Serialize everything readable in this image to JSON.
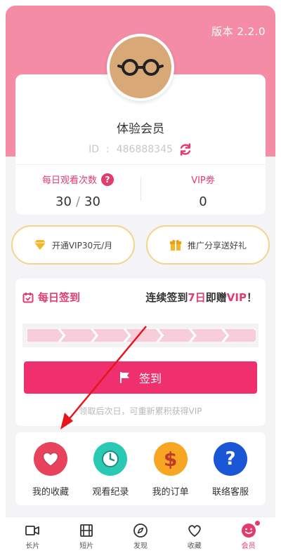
{
  "header": {
    "version": "版本 2.2.0",
    "accent": "#f58ca5"
  },
  "profile": {
    "nickname": "体验会员",
    "id_label": "ID",
    "id_value": "486888345",
    "avatar_icon": "glasses-avatar-icon",
    "refresh_icon": "refresh-icon"
  },
  "stats": {
    "daily_label": "每日观看次数",
    "help_icon_text": "?",
    "daily_used": "30",
    "daily_total": "30",
    "daily_sep": "/",
    "vip_label": "VIP劵",
    "vip_value": "0"
  },
  "promo": {
    "open_vip": "开通VIP30元/月",
    "share": "推广分享送好礼",
    "open_vip_icon": "diamond-icon",
    "share_icon": "gift-icon",
    "border_color": "#f2d58c"
  },
  "signin": {
    "title": "每日签到",
    "promo_prefix": "连续签到",
    "promo_days": "7日",
    "promo_mid": "即赠",
    "promo_vip": "VIP",
    "promo_end": "！",
    "button_label": "签到",
    "note": "领取后次日，可重新累积获得VIP",
    "progress_days": 7,
    "progress_done": 0,
    "accent": "#ef2f6e"
  },
  "quick": [
    {
      "label": "我的收藏",
      "icon": "heart-icon",
      "color": "#e9425c"
    },
    {
      "label": "观看纪录",
      "icon": "clock-icon",
      "color": "#29c9b3"
    },
    {
      "label": "我的订单",
      "icon": "dollar-icon",
      "color": "#f6a623"
    },
    {
      "label": "联络客服",
      "icon": "help-icon",
      "color": "#1a56d6"
    }
  ],
  "tabs": [
    {
      "label": "长片",
      "icon": "video-camera-icon"
    },
    {
      "label": "短片",
      "icon": "film-icon"
    },
    {
      "label": "发现",
      "icon": "compass-icon"
    },
    {
      "label": "收藏",
      "icon": "heart-outline-icon"
    },
    {
      "label": "会员",
      "icon": "member-face-icon",
      "active": true
    }
  ]
}
